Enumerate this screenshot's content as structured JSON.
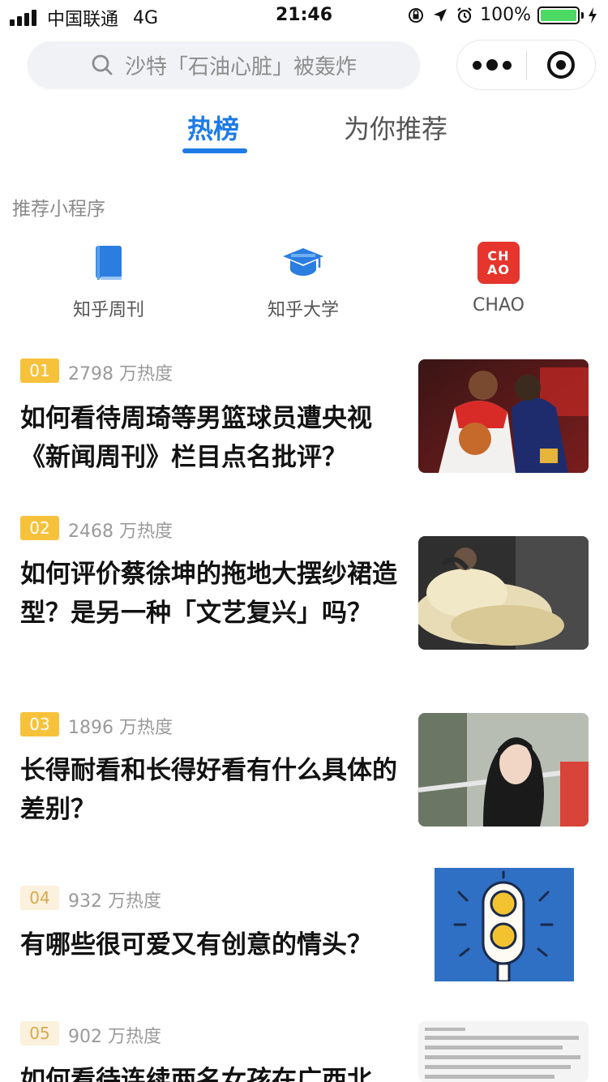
{
  "status_bar": {
    "carrier": "中国联通",
    "network": "4G",
    "time": "21:46",
    "battery": "100%",
    "battery_color": "#4cd964"
  },
  "search": {
    "placeholder": "沙特「石油心脏」被轰炸"
  },
  "capsule": {
    "more_icon": "more-dots-icon",
    "close_icon": "close-target-icon"
  },
  "tabs": [
    {
      "label": "热榜",
      "active": true
    },
    {
      "label": "为你推荐",
      "active": false
    }
  ],
  "accent_color": "#1e7be6",
  "mini_programs": {
    "title": "推荐小程序",
    "items": [
      {
        "label": "知乎周刊",
        "icon": "book-icon"
      },
      {
        "label": "知乎大学",
        "icon": "graduation-cap-icon"
      },
      {
        "label": "CHAO",
        "icon": "chao-logo",
        "logo_text_top": "CH",
        "logo_text_bottom": "AO"
      }
    ]
  },
  "hot_list": [
    {
      "rank": "01",
      "heat": "2798 万热度",
      "title": "如何看待周琦等男篮球员遭央视《新闻周刊》栏目点名批评？",
      "thumb": "basketball-photo"
    },
    {
      "rank": "02",
      "heat": "2468 万热度",
      "title": "如何评价蔡徐坤的拖地大摆纱裙造型？是另一种「文艺复兴」吗？",
      "thumb": "tulle-dress-photo"
    },
    {
      "rank": "03",
      "heat": "1896 万热度",
      "title": "长得耐看和长得好看有什么具体的差别？",
      "thumb": "portrait-photo"
    },
    {
      "rank": "04",
      "heat": "932 万热度",
      "title": "有哪些很可爱又有创意的情头？",
      "thumb": "traffic-light-illustration"
    },
    {
      "rank": "05",
      "heat": "902 万热度",
      "title": "如何看待连续两名女孩在广西北",
      "thumb": "news-screenshot"
    }
  ]
}
